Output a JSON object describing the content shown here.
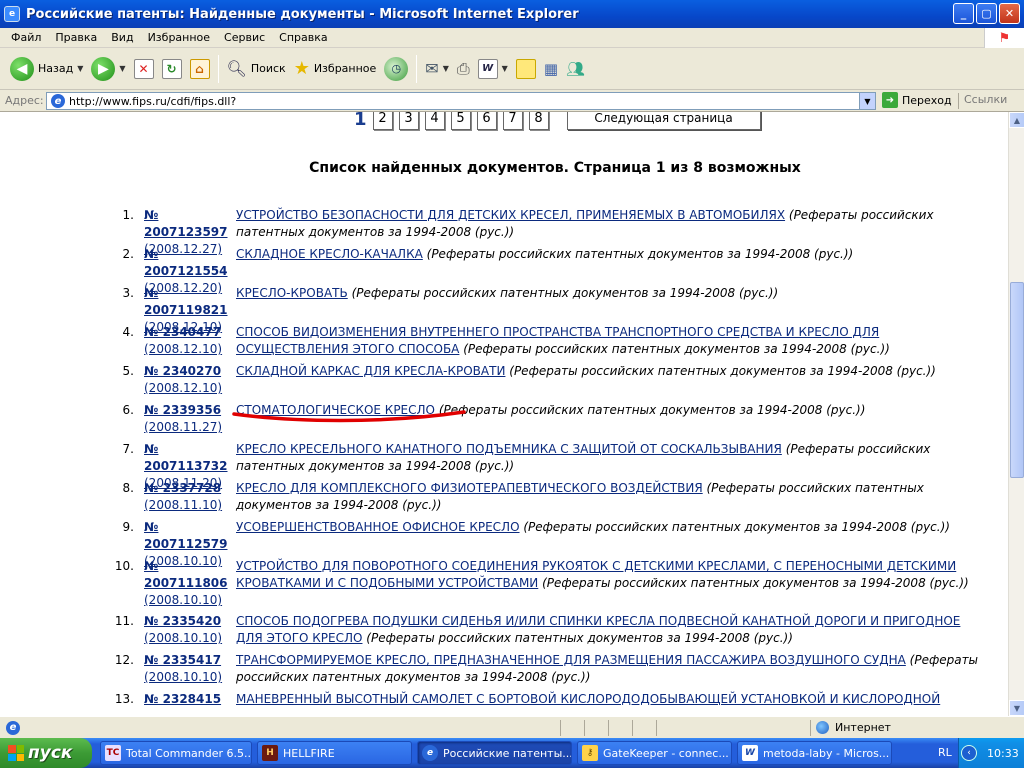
{
  "window": {
    "title": "Российские патенты: Найденные документы - Microsoft Internet Explorer"
  },
  "menu": [
    "Файл",
    "Правка",
    "Вид",
    "Избранное",
    "Сервис",
    "Справка"
  ],
  "toolbar": {
    "back": "Назад",
    "search": "Поиск",
    "favorites": "Избранное"
  },
  "address": {
    "label": "Адрес:",
    "url": "http://www.fips.ru/cdfi/fips.dll?",
    "go": "Переход",
    "links": "Ссылки"
  },
  "pager": {
    "current": "1",
    "pages": [
      "2",
      "3",
      "4",
      "5",
      "6",
      "7",
      "8"
    ],
    "next": "Следующая страница"
  },
  "heading": "Список найденных документов. Страница 1 из 8 возможных",
  "results": [
    {
      "n": "1.",
      "id": "№ 2007123597",
      "date": "(2008.12.27)",
      "title": "УСТРОЙСТВО БЕЗОПАСНОСТИ ДЛЯ ДЕТСКИХ КРЕСЕЛ, ПРИМЕНЯЕМЫХ В АВТОМОБИЛЯХ",
      "source": "(Рефераты российских патентных документов за 1994-2008 (рус.))"
    },
    {
      "n": "2.",
      "id": "№ 2007121554",
      "date": "(2008.12.20)",
      "title": "СКЛАДНОЕ КРЕСЛО-КАЧАЛКА",
      "source": "(Рефераты российских патентных документов за 1994-2008 (рус.))"
    },
    {
      "n": "3.",
      "id": "№ 2007119821",
      "date": "(2008.12.10)",
      "title": "КРЕСЛО-КРОВАТЬ",
      "source": "(Рефераты российских патентных документов за 1994-2008 (рус.))"
    },
    {
      "n": "4.",
      "id": "№ 2340477",
      "date": "(2008.12.10)",
      "title": "СПОСОБ ВИДОИЗМЕНЕНИЯ ВНУТРЕННЕГО ПРОСТРАНСТВА ТРАНСПОРТНОГО СРЕДСТВА И КРЕСЛО ДЛЯ ОСУЩЕСТВЛЕНИЯ ЭТОГО СПОСОБА",
      "source": "(Рефераты российских патентных документов за 1994-2008 (рус.))"
    },
    {
      "n": "5.",
      "id": "№ 2340270",
      "date": "(2008.12.10)",
      "title": "СКЛАДНОЙ КАРКАС ДЛЯ КРЕСЛА-КРОВАТИ",
      "source": "(Рефераты российских патентных документов за 1994-2008 (рус.))"
    },
    {
      "n": "6.",
      "id": "№ 2339356",
      "date": "(2008.11.27)",
      "title": "СТОМАТОЛОГИЧЕСКОЕ КРЕСЛО",
      "source": "(Рефераты российских патентных документов за 1994-2008 (рус.))"
    },
    {
      "n": "7.",
      "id": "№ 2007113732",
      "date": "(2008.11.20)",
      "title": "КРЕСЛО КРЕСЕЛЬНОГО КАНАТНОГО ПОДЪЕМНИКА С ЗАЩИТОЙ ОТ СОСКАЛЬЗЫВАНИЯ",
      "source": "(Рефераты российских патентных документов за 1994-2008 (рус.))"
    },
    {
      "n": "8.",
      "id": "№ 2337728",
      "date": "(2008.11.10)",
      "title": "КРЕСЛО ДЛЯ КОМПЛЕКСНОГО ФИЗИОТЕРАПЕВТИЧЕСКОГО ВОЗДЕЙСТВИЯ",
      "source": "(Рефераты российских патентных документов за 1994-2008 (рус.))"
    },
    {
      "n": "9.",
      "id": "№ 2007112579",
      "date": "(2008.10.10)",
      "title": "УСОВЕРШЕНСТВОВАННОЕ ОФИСНОЕ КРЕСЛО",
      "source": "(Рефераты российских патентных документов за 1994-2008 (рус.))"
    },
    {
      "n": "10.",
      "id": "№ 2007111806",
      "date": "(2008.10.10)",
      "title": "УСТРОЙСТВО ДЛЯ ПОВОРОТНОГО СОЕДИНЕНИЯ РУКОЯТОК С ДЕТСКИМИ КРЕСЛАМИ, С ПЕРЕНОСНЫМИ ДЕТСКИМИ КРОВАТКАМИ И С ПОДОБНЫМИ УСТРОЙСТВАМИ",
      "source": "(Рефераты российских патентных документов за 1994-2008 (рус.))"
    },
    {
      "n": "11.",
      "id": "№ 2335420",
      "date": "(2008.10.10)",
      "title": "СПОСОБ ПОДОГРЕВА ПОДУШКИ СИДЕНЬЯ И/ИЛИ СПИНКИ КРЕСЛА ПОДВЕСНОЙ КАНАТНОЙ ДОРОГИ И ПРИГОДНОЕ ДЛЯ ЭТОГО КРЕСЛО",
      "source": "(Рефераты российских патентных документов за 1994-2008 (рус.))"
    },
    {
      "n": "12.",
      "id": "№ 2335417",
      "date": "(2008.10.10)",
      "title": "ТРАНСФОРМИРУЕМОЕ КРЕСЛО, ПРЕДНАЗНАЧЕННОЕ ДЛЯ РАЗМЕЩЕНИЯ ПАССАЖИРА ВОЗДУШНОГО СУДНА",
      "source": "(Рефераты российских патентных документов за 1994-2008 (рус.))"
    },
    {
      "n": "13.",
      "id": "№ 2328415",
      "date": "",
      "title": "МАНЕВРЕННЫЙ ВЫСОТНЫЙ САМОЛЕТ С БОРТОВОЙ КИСЛОРОДОДОБЫВАЮЩЕЙ УСТАНОВКОЙ И КИСЛОРОДНОЙ",
      "source": ""
    }
  ],
  "status": {
    "zone": "Интернет"
  },
  "taskbar": {
    "start": "пуск",
    "tasks": [
      "Total Commander 6.5...",
      "HELLFIRE",
      "Российские патенты...",
      "GateKeeper - connec...",
      "metoda-laby - Micros..."
    ],
    "lang": "RL",
    "clock": "10:33"
  }
}
